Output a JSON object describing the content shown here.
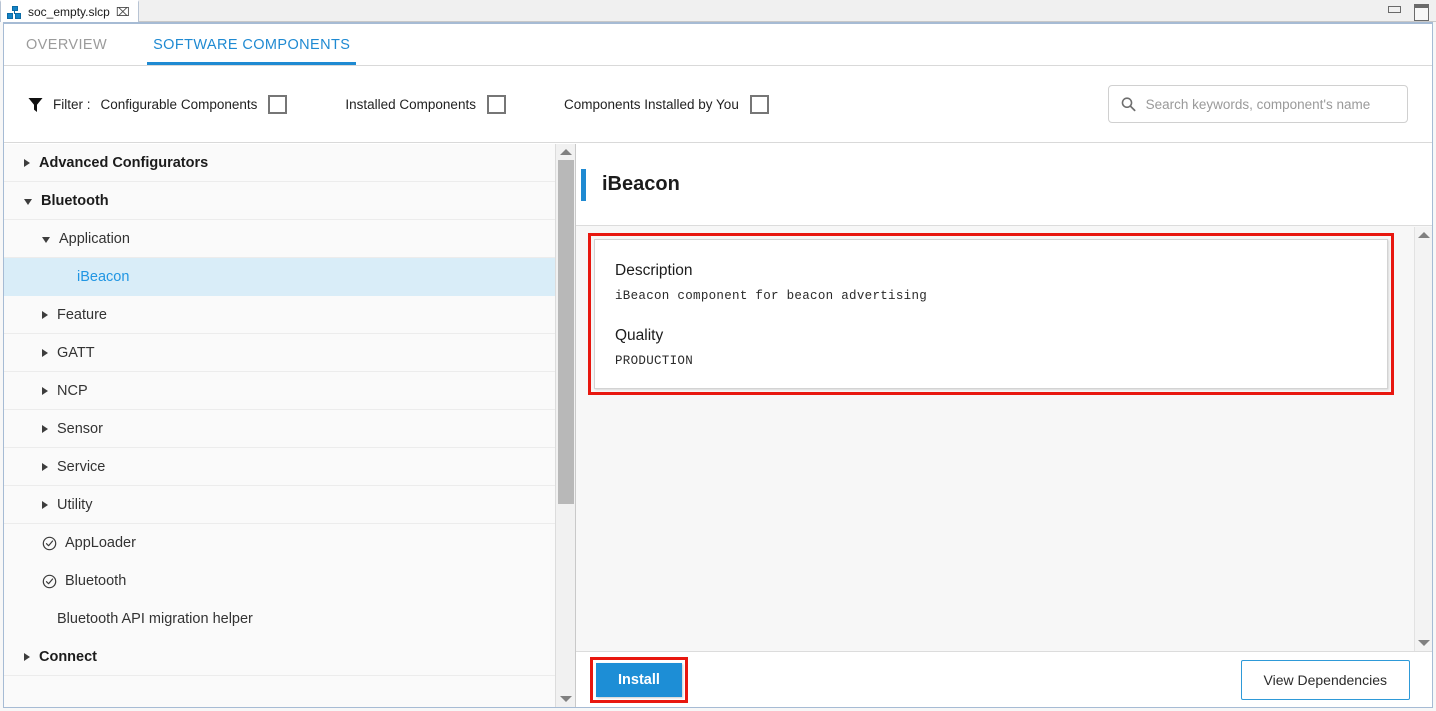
{
  "window": {
    "tab_title": "soc_empty.slcp",
    "tab_icon": "project-hierarchy-icon",
    "close_glyph": "⌧",
    "minimize_label": "Minimize",
    "maximize_label": "Maximize"
  },
  "view_tabs": [
    {
      "label": "OVERVIEW",
      "active": false
    },
    {
      "label": "SOFTWARE COMPONENTS",
      "active": true
    }
  ],
  "filter": {
    "icon": "funnel-icon",
    "label": "Filter :",
    "options": [
      {
        "label": "Configurable Components",
        "checked": false
      },
      {
        "label": "Installed Components",
        "checked": false
      },
      {
        "label": "Components Installed by You",
        "checked": false
      }
    ]
  },
  "search": {
    "icon": "search-icon",
    "placeholder": "Search keywords, component's name",
    "value": ""
  },
  "tree": {
    "rows": [
      {
        "label": "Advanced Configurators",
        "level": 0,
        "toggle": "collapsed",
        "selected": false
      },
      {
        "label": "Bluetooth",
        "level": 0,
        "toggle": "expanded",
        "selected": false
      },
      {
        "label": "Application",
        "level": 1,
        "toggle": "expanded",
        "selected": false
      },
      {
        "label": "iBeacon",
        "level": 2,
        "toggle": "none",
        "selected": true
      },
      {
        "label": "Feature",
        "level": 1,
        "toggle": "collapsed",
        "selected": false
      },
      {
        "label": "GATT",
        "level": 1,
        "toggle": "collapsed",
        "selected": false
      },
      {
        "label": "NCP",
        "level": 1,
        "toggle": "collapsed",
        "selected": false
      },
      {
        "label": "Sensor",
        "level": 1,
        "toggle": "collapsed",
        "selected": false
      },
      {
        "label": "Service",
        "level": 1,
        "toggle": "collapsed",
        "selected": false
      },
      {
        "label": "Utility",
        "level": 1,
        "toggle": "collapsed",
        "selected": false
      },
      {
        "label": "AppLoader",
        "level": 1,
        "toggle": "installed",
        "selected": false
      },
      {
        "label": "Bluetooth",
        "level": 1,
        "toggle": "installed",
        "selected": false
      },
      {
        "label": "Bluetooth API migration helper",
        "level": 1,
        "toggle": "none",
        "selected": false
      },
      {
        "label": "Connect",
        "level": 0,
        "toggle": "collapsed",
        "selected": false
      }
    ]
  },
  "detail": {
    "title": "iBeacon",
    "sections": [
      {
        "heading": "Description",
        "body": "iBeacon component for beacon advertising"
      },
      {
        "heading": "Quality",
        "body": "PRODUCTION"
      }
    ]
  },
  "footer": {
    "install_label": "Install",
    "view_dependencies_label": "View Dependencies"
  },
  "colors": {
    "accent_blue": "#1f8ad2",
    "install_blue": "#1d8ed6",
    "highlight_red": "#e8170f",
    "selected_row": "#d9edf8"
  }
}
